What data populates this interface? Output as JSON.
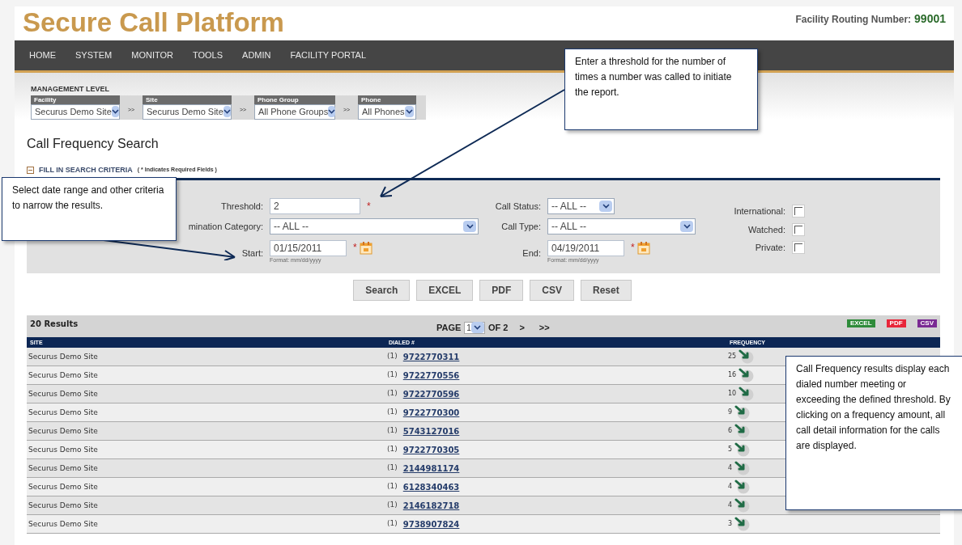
{
  "header": {
    "title": "Secure Call Platform",
    "routing_label": "Facility Routing Number:",
    "routing_number": "99001"
  },
  "nav": [
    "HOME",
    "SYSTEM",
    "MONITOR",
    "TOOLS",
    "ADMIN",
    "FACILITY PORTAL"
  ],
  "management": {
    "title": "MANAGEMENT LEVEL",
    "separator": ">>",
    "levels": [
      {
        "label": "Facility",
        "value": "Securus Demo Site"
      },
      {
        "label": "Site",
        "value": "Securus Demo Site"
      },
      {
        "label": "Phone Group",
        "value": "All Phone Groups"
      },
      {
        "label": "Phone",
        "value": "All Phones"
      }
    ]
  },
  "page_title": "Call Frequency Search",
  "criteria": {
    "title": "FILL IN SEARCH CRITERIA",
    "note": "( * Indicates Required Fields )",
    "expanded": true
  },
  "form": {
    "required_mark": "*",
    "threshold": {
      "label": "Threshold:",
      "value": "2"
    },
    "termination": {
      "label": "mination Category:",
      "value": "-- ALL --"
    },
    "start": {
      "label": "Start:",
      "value": "01/15/2011",
      "format": "Format: mm/dd/yyyy"
    },
    "call_status": {
      "label": "Call Status:",
      "value": "-- ALL --"
    },
    "call_type": {
      "label": "Call Type:",
      "value": "-- ALL --"
    },
    "end": {
      "label": "End:",
      "value": "04/19/2011",
      "format": "Format: mm/dd/yyyy"
    },
    "flags": [
      {
        "label": "International:",
        "checked": false
      },
      {
        "label": "Watched:",
        "checked": false
      },
      {
        "label": "Private:",
        "checked": false
      }
    ]
  },
  "buttons": [
    "Search",
    "EXCEL",
    "PDF",
    "CSV",
    "Reset"
  ],
  "results": {
    "count": "20 Results",
    "page_label": "PAGE",
    "page": "1",
    "of": "OF 2",
    "next": ">",
    "last": ">>",
    "exports": [
      {
        "label": "EXCEL",
        "color": "#2e8b3a"
      },
      {
        "label": "PDF",
        "color": "#e8263a"
      },
      {
        "label": "CSV",
        "color": "#7a2a93"
      }
    ],
    "columns": [
      "SITE",
      "DIALED #",
      "FREQUENCY"
    ],
    "rows": [
      {
        "site": "Securus Demo Site",
        "prefix": "(1)",
        "number": "9722770311",
        "frequency": "25"
      },
      {
        "site": "Securus Demo Site",
        "prefix": "(1)",
        "number": "9722770556",
        "frequency": "16"
      },
      {
        "site": "Securus Demo Site",
        "prefix": "(1)",
        "number": "9722770596",
        "frequency": "10"
      },
      {
        "site": "Securus Demo Site",
        "prefix": "(1)",
        "number": "9722770300",
        "frequency": "9"
      },
      {
        "site": "Securus Demo Site",
        "prefix": "(1)",
        "number": "5743127016",
        "frequency": "6"
      },
      {
        "site": "Securus Demo Site",
        "prefix": "(1)",
        "number": "9722770305",
        "frequency": "5"
      },
      {
        "site": "Securus Demo Site",
        "prefix": "(1)",
        "number": "2144981174",
        "frequency": "4"
      },
      {
        "site": "Securus Demo Site",
        "prefix": "(1)",
        "number": "6128340463",
        "frequency": "4"
      },
      {
        "site": "Securus Demo Site",
        "prefix": "(1)",
        "number": "2146182718",
        "frequency": "4"
      },
      {
        "site": "Securus Demo Site",
        "prefix": "(1)",
        "number": "9738907824",
        "frequency": "3"
      }
    ]
  },
  "callouts": [
    {
      "text": "Enter a threshold for the number of times a number was called to initiate the report."
    },
    {
      "text": "Select date range and other criteria to narrow the results."
    },
    {
      "text": "Call Frequency results display each dialed number meeting or exceeding the defined threshold.  By clicking on a frequency amount, all call detail information  for the calls are displayed."
    }
  ]
}
